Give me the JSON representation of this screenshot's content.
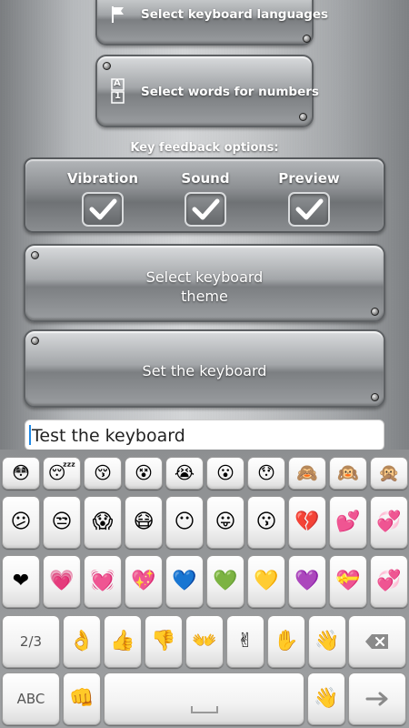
{
  "menu": {
    "languages_label": "Select keyboard languages",
    "numbers_label": "Select words for numbers",
    "numbers_icon_top": "A",
    "numbers_icon_bottom": "1"
  },
  "feedback": {
    "title": "Key feedback options:",
    "vibration_label": "Vibration",
    "sound_label": "Sound",
    "preview_label": "Preview",
    "vibration_checked": true,
    "sound_checked": true,
    "preview_checked": true
  },
  "buttons": {
    "theme_line1": "Select keyboard",
    "theme_line2": "theme",
    "set_keyboard": "Set the keyboard"
  },
  "test_input": {
    "value": "Test the keyboard"
  },
  "keyboard": {
    "row1": [
      "😳",
      "😴",
      "😚",
      "😵",
      "😭",
      "😮",
      "😯",
      "🙈",
      "🙉",
      "🙊"
    ],
    "row2": [
      "😕",
      "😒",
      "😱",
      "😷",
      "😶",
      "😛",
      "😗",
      "💔",
      "💕",
      "💞"
    ],
    "row3": [
      "❤",
      "💗",
      "💓",
      "💖",
      "💙",
      "💚",
      "💛",
      "💜",
      "💝",
      "💞"
    ],
    "row4": [
      "👌",
      "👍",
      "👎",
      "👐",
      "✌",
      "✋",
      "👋"
    ],
    "page_label": "2/3",
    "abc_label": "ABC",
    "fist_emoji": "👊",
    "wave_emoji": "👋",
    "icons": {
      "backspace": "backspace-icon",
      "enter": "enter-arrow-icon",
      "space": "space-icon",
      "flag": "flag-icon"
    }
  }
}
